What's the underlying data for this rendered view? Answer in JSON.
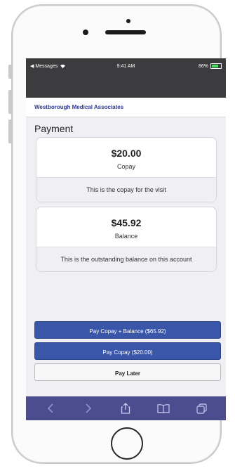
{
  "status_bar": {
    "carrier": "◀ Messages",
    "time": "9:41 AM",
    "battery": "86%"
  },
  "practice_name": "Westborough Medical Associates",
  "section_title": "Payment",
  "cards": [
    {
      "amount": "$20.00",
      "label": "Copay",
      "description": "This is the copay for the visit"
    },
    {
      "amount": "$45.92",
      "label": "Balance",
      "description": "This is the outstanding balance on this account"
    }
  ],
  "actions": {
    "pay_both": "Pay Copay + Balance ($65.92)",
    "pay_copay": "Pay Copay ($20.00)",
    "pay_later": "Pay Later"
  },
  "toolbar": {
    "icons": [
      "back-icon",
      "forward-icon",
      "share-icon",
      "bookmarks-icon",
      "tabs-icon"
    ]
  },
  "colors": {
    "primary_button": "#3a56a9",
    "practice_text": "#2f3a8f",
    "toolbar": "#4b4d8f",
    "status_bar": "#3c3c3e"
  }
}
